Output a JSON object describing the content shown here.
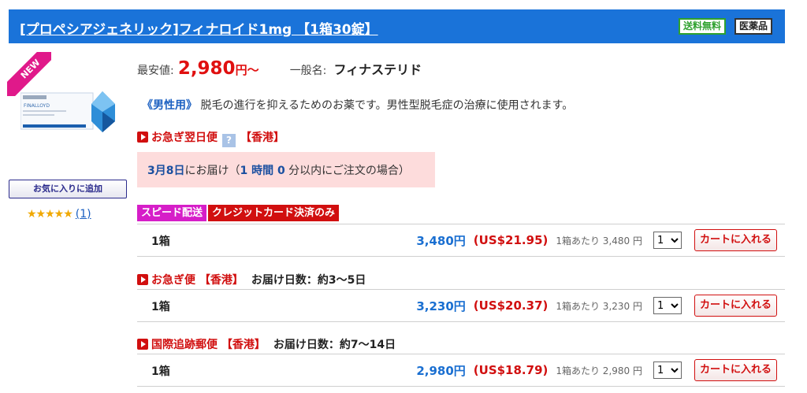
{
  "header": {
    "title": "[プロペシアジェネリック]フィナロイド1mg 【1箱30錠】",
    "badge_free_shipping": "送料無料",
    "badge_medicine": "医薬品"
  },
  "product": {
    "new_label": "NEW",
    "image_text": "FINALLOYD",
    "favorite_button": "お気に入りに追加",
    "rating_stars": "★★★★★",
    "rating_count": "1",
    "lowest_price_label": "最安値:",
    "lowest_price": "2,980",
    "lowest_price_suffix": "円〜",
    "generic_label": "一般名:",
    "generic_name": "フィナステリド",
    "desc_tag": "《男性用》",
    "description": "脱毛の進行を抑えるためのお薬です。男性型脱毛症の治療に使用されます。"
  },
  "shipping_express": {
    "name": "お急ぎ翌日便",
    "help_icon": "?",
    "origin": "【香港】",
    "delivery_date": "3月8日",
    "delivery_text": "にお届け（",
    "hours": "1 時間 0",
    "delivery_tail": " 分以内にご注文の場合）",
    "tag_speed": "スピード配送",
    "tag_card": "クレジットカード決済のみ"
  },
  "offers": [
    {
      "qty": "1箱",
      "price_yen": "3,480円",
      "price_usd": "(US$21.95)",
      "per_box": "1箱あたり 3,480 円",
      "select_value": "1",
      "cart_label": "カートに入れる"
    },
    {
      "qty": "1箱",
      "price_yen": "3,230円",
      "price_usd": "(US$20.37)",
      "per_box": "1箱あたり 3,230 円",
      "select_value": "1",
      "cart_label": "カートに入れる"
    },
    {
      "qty": "1箱",
      "price_yen": "2,980円",
      "price_usd": "(US$18.79)",
      "per_box": "1箱あたり 2,980 円",
      "select_value": "1",
      "cart_label": "カートに入れる"
    }
  ],
  "shipping_fast": {
    "name": "お急ぎ便",
    "origin": "【香港】",
    "days": "お届け日数：約3〜5日"
  },
  "shipping_intl": {
    "name": "国際追跡郵便",
    "origin": "【香港】",
    "days": "お届け日数：約7〜14日"
  },
  "colors": {
    "header_blue": "#1a73d9",
    "price_red": "#e01010",
    "badge_green": "#2ea12e",
    "new_pink": "#e0198a"
  }
}
